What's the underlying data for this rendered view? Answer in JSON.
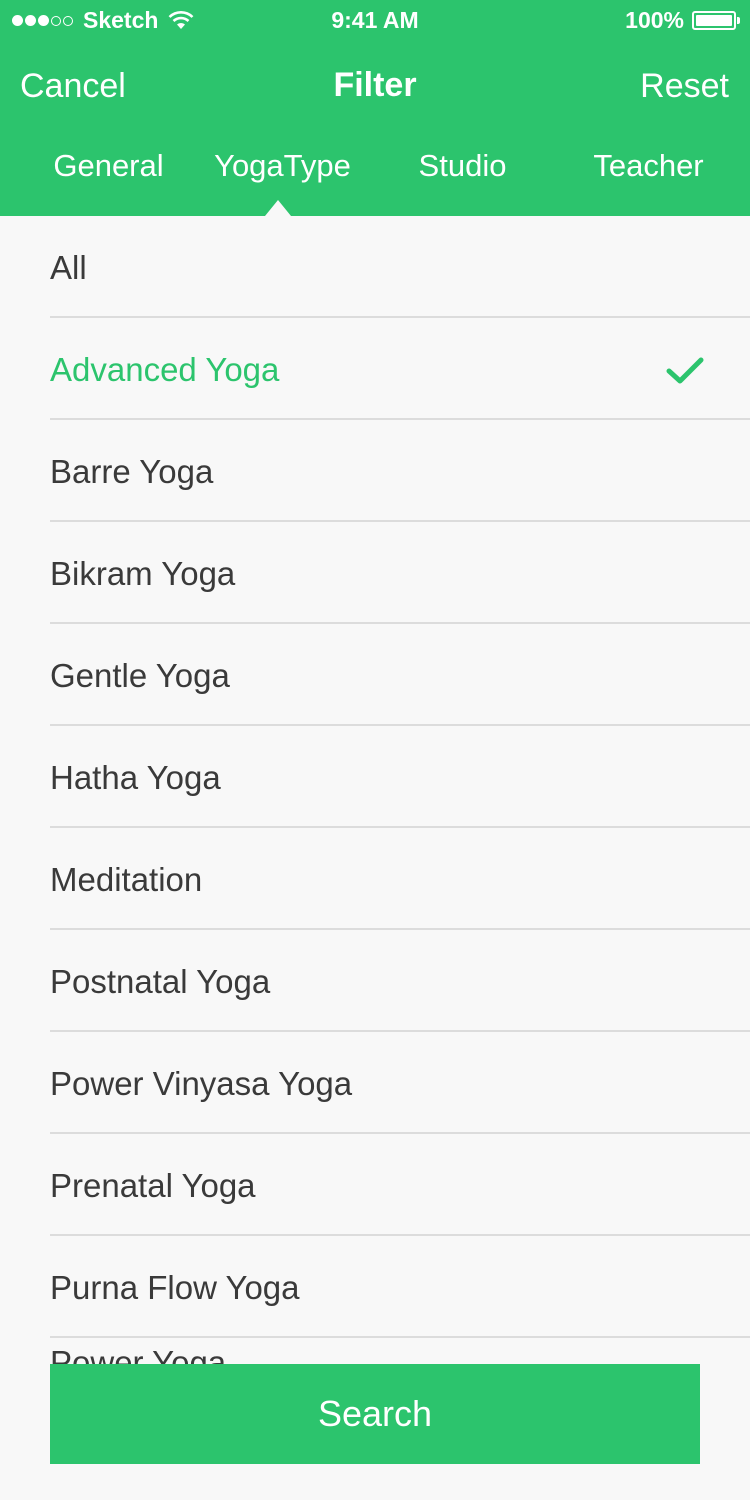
{
  "status_bar": {
    "carrier": "Sketch",
    "time": "9:41 AM",
    "battery": "100%"
  },
  "nav": {
    "cancel_label": "Cancel",
    "title": "Filter",
    "reset_label": "Reset"
  },
  "tabs": [
    {
      "label": "General"
    },
    {
      "label": "YogaType"
    },
    {
      "label": "Studio"
    },
    {
      "label": "Teacher"
    }
  ],
  "list": {
    "items": [
      {
        "label": "All"
      },
      {
        "label": "Advanced Yoga"
      },
      {
        "label": "Barre Yoga"
      },
      {
        "label": "Bikram Yoga"
      },
      {
        "label": "Gentle Yoga"
      },
      {
        "label": "Hatha Yoga"
      },
      {
        "label": "Meditation"
      },
      {
        "label": "Postnatal Yoga"
      },
      {
        "label": "Power Vinyasa Yoga"
      },
      {
        "label": "Prenatal Yoga"
      },
      {
        "label": "Purna Flow Yoga"
      }
    ],
    "partial_item": "Power Yoga",
    "selected_index": 1
  },
  "search_button": {
    "label": "Search"
  },
  "colors": {
    "accent": "#2cc46d",
    "background": "#f8f8f8",
    "divider": "#dcdcdc",
    "text": "#3a3a3a"
  },
  "icons": [
    "signal-dots-icon",
    "wifi-icon",
    "battery-icon",
    "checkmark-icon"
  ]
}
